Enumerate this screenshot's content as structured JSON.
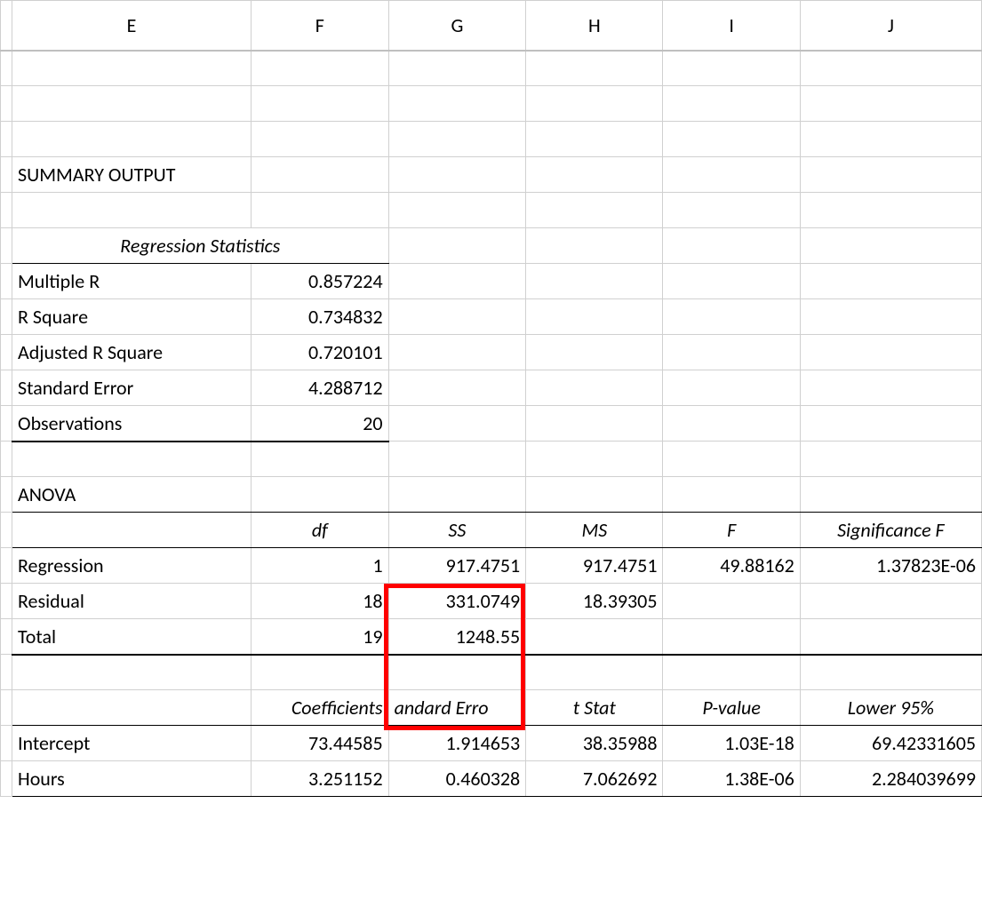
{
  "columns": {
    "E": "E",
    "F": "F",
    "G": "G",
    "H": "H",
    "I": "I",
    "J": "J"
  },
  "summary_title": "SUMMARY OUTPUT",
  "regstats_hdr": "Regression Statistics",
  "regstats": {
    "multipleR_label": "Multiple R",
    "multipleR_val": "0.857224",
    "rSquare_label": "R Square",
    "rSquare_val": "0.734832",
    "adjRSquare_label": "Adjusted R Square",
    "adjRSquare_val": "0.720101",
    "stdErr_label": "Standard Error",
    "stdErr_val": "4.288712",
    "obs_label": "Observations",
    "obs_val": "20"
  },
  "anova_title": "ANOVA",
  "anova_hdr": {
    "df": "df",
    "SS": "SS",
    "MS": "MS",
    "F": "F",
    "sigF": "Significance F"
  },
  "anova": {
    "regression_label": "Regression",
    "regression": {
      "df": "1",
      "SS": "917.4751",
      "MS": "917.4751",
      "F": "49.88162",
      "sigF": "1.37823E-06"
    },
    "residual_label": "Residual",
    "residual": {
      "df": "18",
      "SS": "331.0749",
      "MS": "18.39305"
    },
    "total_label": "Total",
    "total": {
      "df": "19",
      "SS": "1248.55"
    }
  },
  "coef_hdr": {
    "coefficients": "Coefficients",
    "stdErr": "andard Erro",
    "tStat": "t Stat",
    "pValue": "P-value",
    "lower95": "Lower 95%"
  },
  "coef": {
    "intercept_label": "Intercept",
    "intercept": {
      "coef": "73.44585",
      "se": "1.914653",
      "t": "38.35988",
      "p": "1.03E-18",
      "lo": "69.42331605"
    },
    "hours_label": "Hours",
    "hours": {
      "coef": "3.251152",
      "se": "0.460328",
      "t": "7.062692",
      "p": "1.38E-06",
      "lo": "2.284039699"
    }
  }
}
